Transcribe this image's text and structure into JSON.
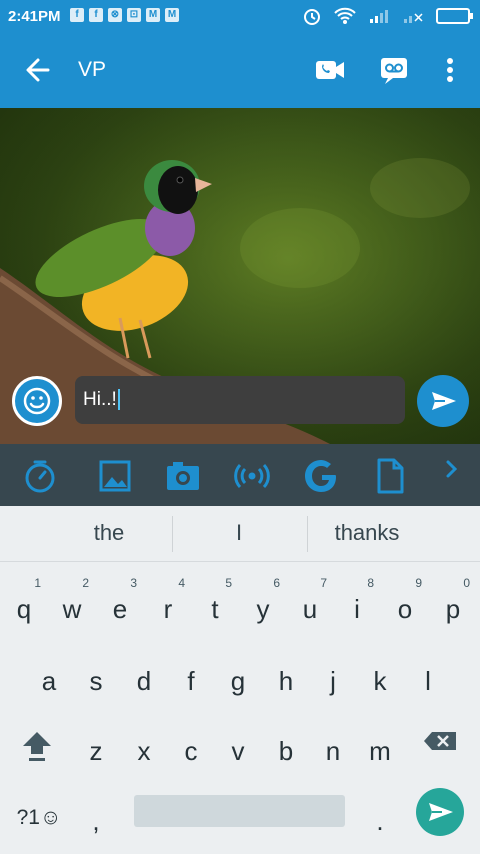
{
  "status": {
    "time": "2:41PM",
    "notifications": [
      "f",
      "f",
      "⊗",
      "⊡",
      "M",
      "M"
    ]
  },
  "appbar": {
    "title": "VP",
    "back_icon": "arrow-back-icon",
    "actions": [
      "video-call-icon",
      "voicemail-icon",
      "more-vert-icon"
    ]
  },
  "composer": {
    "input_value": "Hi..!",
    "emoji_icon": "emoji-icon",
    "send_icon": "send-icon"
  },
  "attach_toolbar": [
    "timer-icon",
    "image-icon",
    "camera-icon",
    "broadcast-icon",
    "google-icon",
    "document-icon",
    "chevron-right-icon"
  ],
  "suggestions": [
    "the",
    "I",
    "thanks"
  ],
  "keyboard": {
    "row1": [
      {
        "l": "q",
        "h": "1"
      },
      {
        "l": "w",
        "h": "2"
      },
      {
        "l": "e",
        "h": "3"
      },
      {
        "l": "r",
        "h": "4"
      },
      {
        "l": "t",
        "h": "5"
      },
      {
        "l": "y",
        "h": "6"
      },
      {
        "l": "u",
        "h": "7"
      },
      {
        "l": "i",
        "h": "8"
      },
      {
        "l": "o",
        "h": "9"
      },
      {
        "l": "p",
        "h": "0"
      }
    ],
    "row2": [
      "a",
      "s",
      "d",
      "f",
      "g",
      "h",
      "j",
      "k",
      "l"
    ],
    "row3": [
      "z",
      "x",
      "c",
      "v",
      "b",
      "n",
      "m"
    ],
    "symbols_label": "?1☺",
    "comma": ",",
    "period": "."
  },
  "colors": {
    "accent": "#1E8FCF",
    "toolbar": "#37474F",
    "input_bg": "#3E3E3E",
    "keyboard_send": "#26A69A"
  }
}
